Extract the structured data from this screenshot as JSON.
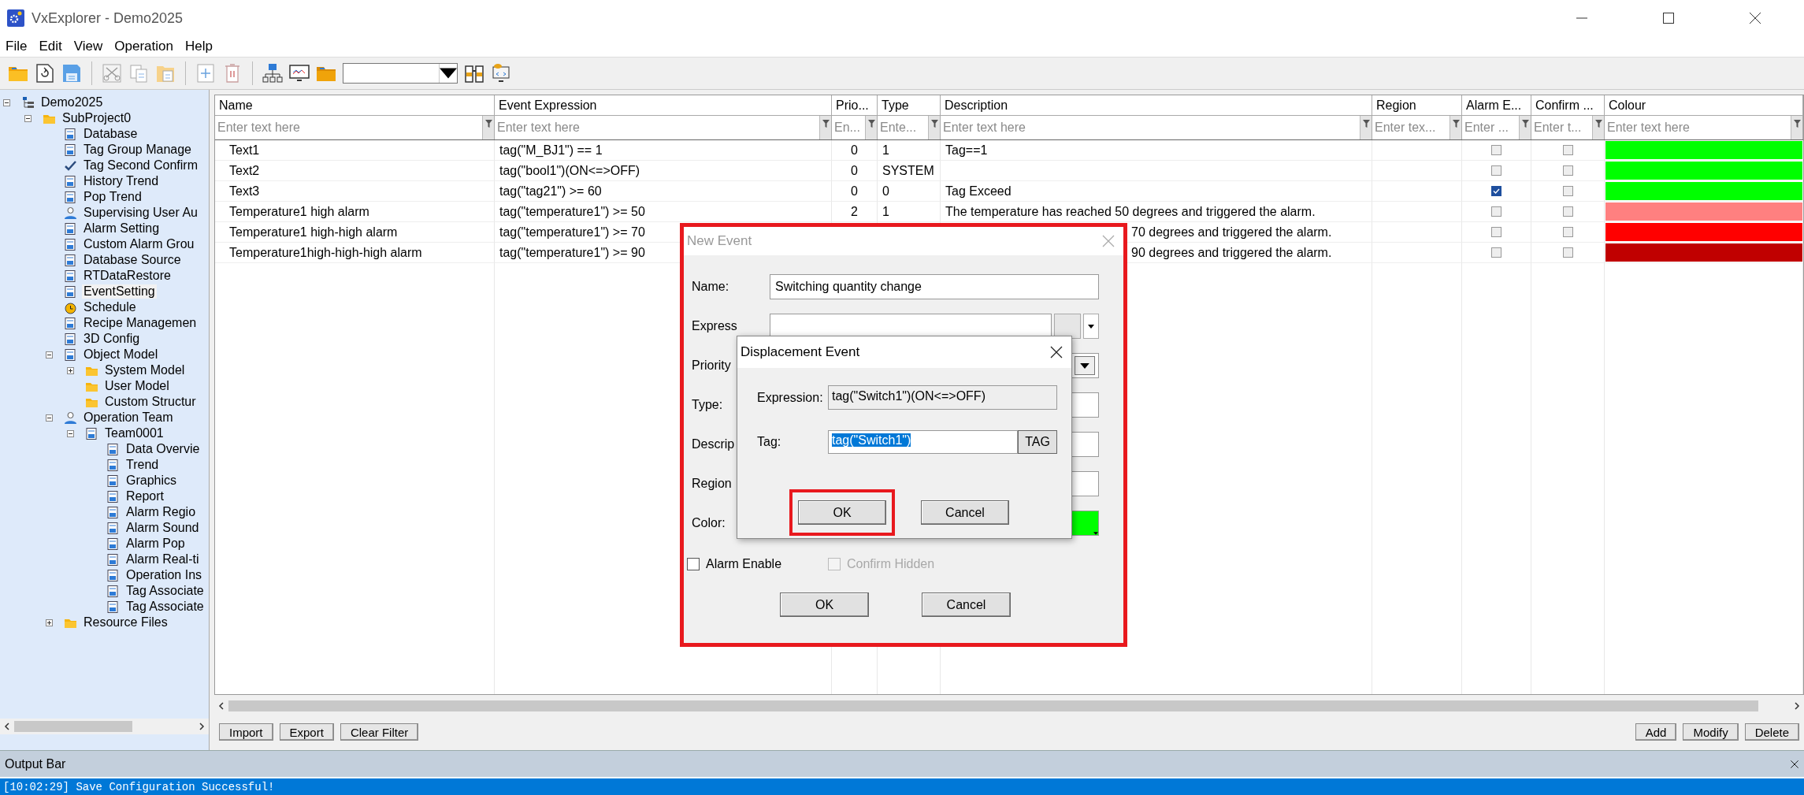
{
  "window": {
    "title": "VxExplorer - Demo2025"
  },
  "menu": [
    "File",
    "Edit",
    "View",
    "Operation",
    "Help"
  ],
  "tree": [
    {
      "label": "Demo2025",
      "kind": "project",
      "selected": false,
      "expanded": true,
      "children": [
        {
          "label": "SubProject0",
          "kind": "folder",
          "selected": false,
          "expanded": true,
          "children": [
            {
              "label": "Database",
              "kind": "item",
              "selected": false
            },
            {
              "label": "Tag Group Manage",
              "kind": "item",
              "selected": false
            },
            {
              "label": "Tag Second Confirm",
              "kind": "check",
              "selected": false
            },
            {
              "label": "History Trend",
              "kind": "item",
              "selected": false
            },
            {
              "label": "Pop Trend",
              "kind": "item",
              "selected": false
            },
            {
              "label": "Supervising User Au",
              "kind": "team",
              "selected": false
            },
            {
              "label": "Alarm Setting",
              "kind": "item",
              "selected": false
            },
            {
              "label": "Custom Alarm Grou",
              "kind": "item",
              "selected": false
            },
            {
              "label": "Database Source",
              "kind": "item",
              "selected": false
            },
            {
              "label": "RTDataRestore",
              "kind": "item",
              "selected": false
            },
            {
              "label": "EventSetting",
              "kind": "item",
              "selected": true
            },
            {
              "label": "Schedule",
              "kind": "clock",
              "selected": false
            },
            {
              "label": "Recipe Managemen",
              "kind": "item",
              "selected": false
            },
            {
              "label": "3D Config",
              "kind": "item",
              "selected": false
            },
            {
              "label": "Object Model",
              "kind": "item",
              "selected": false,
              "expanded": true,
              "children": [
                {
                  "label": "System Model",
                  "kind": "folder",
                  "selected": false,
                  "expanded": false
                },
                {
                  "label": "User Model",
                  "kind": "folder",
                  "selected": false
                },
                {
                  "label": "Custom Structur",
                  "kind": "folder",
                  "selected": false
                }
              ]
            },
            {
              "label": "Operation Team",
              "kind": "team",
              "selected": false,
              "expanded": true,
              "children": [
                {
                  "label": "Team0001",
                  "kind": "item",
                  "selected": false,
                  "expanded": true,
                  "children": [
                    {
                      "label": "Data Overvie",
                      "kind": "item",
                      "selected": false
                    },
                    {
                      "label": "Trend",
                      "kind": "item",
                      "selected": false
                    },
                    {
                      "label": "Graphics",
                      "kind": "item",
                      "selected": false
                    },
                    {
                      "label": "Report",
                      "kind": "item",
                      "selected": false
                    },
                    {
                      "label": "Alarm Regio",
                      "kind": "item",
                      "selected": false
                    },
                    {
                      "label": "Alarm Sound",
                      "kind": "item",
                      "selected": false
                    },
                    {
                      "label": "Alarm Pop",
                      "kind": "item",
                      "selected": false
                    },
                    {
                      "label": "Alarm Real-ti",
                      "kind": "item",
                      "selected": false
                    },
                    {
                      "label": "Operation Ins",
                      "kind": "item",
                      "selected": false
                    },
                    {
                      "label": "Tag Associate",
                      "kind": "item",
                      "selected": false
                    },
                    {
                      "label": "Tag Associate",
                      "kind": "item",
                      "selected": false
                    }
                  ]
                }
              ]
            },
            {
              "label": "Resource Files",
              "kind": "folder",
              "selected": false,
              "expanded": false
            }
          ]
        }
      ]
    }
  ],
  "grid": {
    "columns": [
      {
        "label": "Name",
        "filter_placeholder": "Enter text here"
      },
      {
        "label": "Event Expression",
        "filter_placeholder": "Enter text here"
      },
      {
        "label": "Prio...",
        "filter_placeholder": "En..."
      },
      {
        "label": "Type",
        "filter_placeholder": "Ente..."
      },
      {
        "label": "Description",
        "filter_placeholder": "Enter text here"
      },
      {
        "label": "Region",
        "filter_placeholder": "Enter tex..."
      },
      {
        "label": "Alarm E...",
        "filter_placeholder": "Enter ..."
      },
      {
        "label": "Confirm ...",
        "filter_placeholder": "Enter t..."
      },
      {
        "label": "Colour",
        "filter_placeholder": "Enter text here"
      }
    ],
    "rows": [
      {
        "name": "Text1",
        "expression": "tag(\"M_BJ1\") == 1",
        "priority": "0",
        "type": "1",
        "description": "Tag==1",
        "covered": false,
        "alarm_enabled": false,
        "confirm": false,
        "color": "#00ff00"
      },
      {
        "name": "Text2",
        "expression": "tag(\"bool1\")(ON<=>OFF)",
        "priority": "0",
        "type": "SYSTEM",
        "covered": false,
        "alarm_enabled": false,
        "confirm": false,
        "color": "#00ff00"
      },
      {
        "name": "Text3",
        "expression": "tag(\"tag21\") >= 60",
        "priority": "0",
        "type": "0",
        "description": "Tag Exceed",
        "covered": false,
        "alarm_enabled": true,
        "confirm": false,
        "color": "#00ff00"
      },
      {
        "name": "Temperature1 high alarm",
        "expression": "tag(\"temperature1\") >= 50",
        "priority": "2",
        "type": "1",
        "description": "The temperature has reached 50 degrees and triggered the alarm.",
        "covered": false,
        "alarm_enabled": false,
        "confirm": false,
        "color": "#ff8080"
      },
      {
        "name": "Temperature1 high-high alarm",
        "expression": "tag(\"temperature1\") >= 70",
        "description": "70 degrees and triggered the alarm.",
        "covered": true,
        "alarm_enabled": false,
        "confirm": false,
        "color": "#ff0000"
      },
      {
        "name": "Temperature1high-high-high alarm",
        "expression": "tag(\"temperature1\") >= 90",
        "description": "90 degrees and triggered the alarm.",
        "covered": true,
        "alarm_enabled": false,
        "confirm": false,
        "color": "#c00000"
      }
    ]
  },
  "buttons_left": [
    "Import",
    "Export",
    "Clear Filter"
  ],
  "buttons_right": [
    "Add",
    "Modify",
    "Delete"
  ],
  "output_bar": {
    "title": "Output Bar",
    "lines": [
      {
        "text": "[10:02:29] Save Configuration Successful!",
        "selected": true
      }
    ]
  },
  "new_event": {
    "title": "New Event",
    "fields": [
      {
        "label": "Name:",
        "kind": "text",
        "value": "Switching quantity change"
      },
      {
        "label": "Express",
        "kind": "expression"
      },
      {
        "label": "Priority",
        "kind": "dropdown"
      },
      {
        "label": "Type:",
        "kind": "text"
      },
      {
        "label": "Descrip",
        "kind": "text"
      },
      {
        "label": "Region",
        "kind": "text"
      },
      {
        "label": "Color:",
        "kind": "color",
        "color": "#00ff00"
      }
    ],
    "checks": [
      {
        "label": "Alarm Enable",
        "checked": false,
        "disabled": false
      },
      {
        "label": "Confirm Hidden",
        "checked": false,
        "disabled": true
      }
    ],
    "buttons": [
      "OK",
      "Cancel"
    ]
  },
  "displacement_event": {
    "title": "Displacement Event",
    "expression_label": "Expression:",
    "expression": "tag(\"Switch1\")(ON<=>OFF)",
    "tag_label": "Tag:",
    "tag_value": "tag(\"Switch1\")",
    "tag_value_selected": true,
    "tag_button": "TAG",
    "buttons": [
      {
        "label": "OK",
        "highlighted": true
      },
      {
        "label": "Cancel",
        "highlighted": false
      }
    ]
  }
}
